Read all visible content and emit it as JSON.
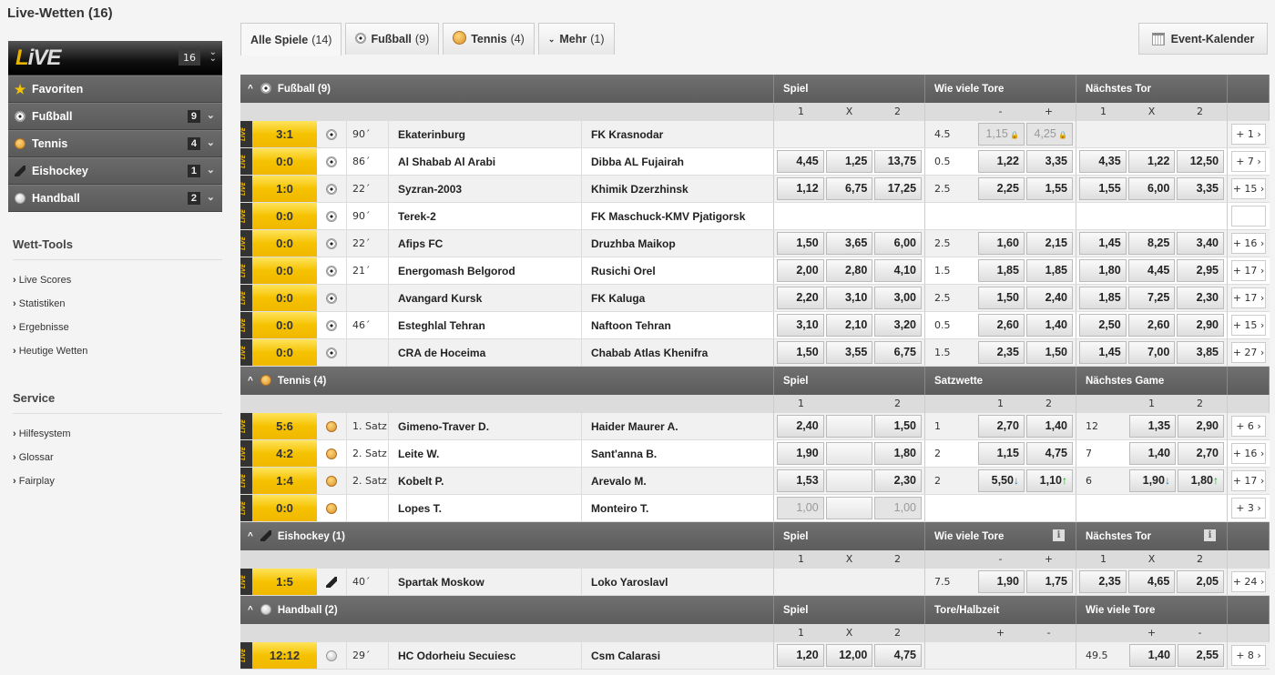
{
  "page": {
    "title": "Live-Wetten (16)"
  },
  "sidebar": {
    "live_logo": {
      "l": "L",
      "rest": "iVE"
    },
    "live_count": "16",
    "items": [
      {
        "label": "Favoriten",
        "icon": "star-icon",
        "count": null
      },
      {
        "label": "Fußball",
        "icon": "soccer-ball-icon",
        "count": "9"
      },
      {
        "label": "Tennis",
        "icon": "tennis-ball-icon",
        "count": "4"
      },
      {
        "label": "Eishockey",
        "icon": "hockey-stick-icon",
        "count": "1"
      },
      {
        "label": "Handball",
        "icon": "handball-icon",
        "count": "2"
      }
    ],
    "wett_tools": {
      "title": "Wett-Tools",
      "links": [
        "Live Scores",
        "Statistiken",
        "Ergebnisse",
        "Heutige Wetten"
      ]
    },
    "service": {
      "title": "Service",
      "links": [
        "Hilfesystem",
        "Glossar",
        "Fairplay"
      ]
    }
  },
  "tabs": [
    {
      "label": "Alle Spiele",
      "count": "(14)",
      "active": true
    },
    {
      "label": "Fußball",
      "count": "(9)",
      "icon": "soccer-ball-icon"
    },
    {
      "label": "Tennis",
      "count": "(4)",
      "icon": "tennis-ball-icon"
    },
    {
      "label": "Mehr",
      "count": "(1)",
      "icon": "chevron-down-icon"
    }
  ],
  "event_calendar": {
    "label": "Event-Kalender"
  },
  "sections": [
    {
      "title": "Fußball (9)",
      "sport": "soccer",
      "markets": [
        {
          "title": "Spiel",
          "cols": [
            "1",
            "X",
            "2"
          ],
          "info": false
        },
        {
          "title": "Wie viele Tore",
          "cols": [
            "",
            "-",
            "+"
          ],
          "info": false
        },
        {
          "title": "Nächstes Tor",
          "cols": [
            "1",
            "X",
            "2"
          ],
          "info": false
        }
      ],
      "rows": [
        {
          "score": "3:1",
          "time": "90´",
          "home": "Ekaterinburg",
          "away": "FK Krasnodar",
          "m1": null,
          "m2": {
            "line": "4.5",
            "odds": [
              "1,15",
              "4,25"
            ],
            "locked": true
          },
          "m3": null,
          "more": "+ 1"
        },
        {
          "score": "0:0",
          "time": "86´",
          "home": "Al Shabab Al Arabi",
          "away": "Dibba AL Fujairah",
          "m1": [
            "4,45",
            "1,25",
            "13,75"
          ],
          "m2": {
            "line": "0.5",
            "odds": [
              "1,22",
              "3,35"
            ]
          },
          "m3": [
            "4,35",
            "1,22",
            "12,50"
          ],
          "more": "+ 7"
        },
        {
          "score": "1:0",
          "time": "22´",
          "home": "Syzran-2003",
          "away": "Khimik Dzerzhinsk",
          "m1": [
            "1,12",
            "6,75",
            "17,25"
          ],
          "m2": {
            "line": "2.5",
            "odds": [
              "2,25",
              "1,55"
            ]
          },
          "m3": [
            "1,55",
            "6,00",
            "3,35"
          ],
          "more": "+ 15"
        },
        {
          "score": "0:0",
          "time": "90´",
          "home": "Terek-2",
          "away": "FK Maschuck-KMV Pjatigorsk",
          "m1": null,
          "m2": null,
          "m3": null,
          "more": ""
        },
        {
          "score": "0:0",
          "time": "22´",
          "home": "Afips FC",
          "away": "Druzhba Maikop",
          "m1": [
            "1,50",
            "3,65",
            "6,00"
          ],
          "m2": {
            "line": "2.5",
            "odds": [
              "1,60",
              "2,15"
            ]
          },
          "m3": [
            "1,45",
            "8,25",
            "3,40"
          ],
          "more": "+ 16"
        },
        {
          "score": "0:0",
          "time": "21´",
          "home": "Energomash Belgorod",
          "away": "Rusichi Orel",
          "m1": [
            "2,00",
            "2,80",
            "4,10"
          ],
          "m2": {
            "line": "1.5",
            "odds": [
              "1,85",
              "1,85"
            ]
          },
          "m3": [
            "1,80",
            "4,45",
            "2,95"
          ],
          "more": "+ 17"
        },
        {
          "score": "0:0",
          "time": "",
          "home": "Avangard Kursk",
          "away": "FK Kaluga",
          "m1": [
            "2,20",
            "3,10",
            "3,00"
          ],
          "m2": {
            "line": "2.5",
            "odds": [
              "1,50",
              "2,40"
            ]
          },
          "m3": [
            "1,85",
            "7,25",
            "2,30"
          ],
          "more": "+ 17"
        },
        {
          "score": "0:0",
          "time": "46´",
          "home": "Esteghlal Tehran",
          "away": "Naftoon Tehran",
          "m1": [
            "3,10",
            "2,10",
            "3,20"
          ],
          "m2": {
            "line": "0.5",
            "odds": [
              "2,60",
              "1,40"
            ]
          },
          "m3": [
            "2,50",
            "2,60",
            "2,90"
          ],
          "more": "+ 15"
        },
        {
          "score": "0:0",
          "time": "",
          "home": "CRA de Hoceima",
          "away": "Chabab Atlas Khenifra",
          "m1": [
            "1,50",
            "3,55",
            "6,75"
          ],
          "m2": {
            "line": "1.5",
            "odds": [
              "2,35",
              "1,50"
            ]
          },
          "m3": [
            "1,45",
            "7,00",
            "3,85"
          ],
          "more": "+ 27"
        }
      ]
    },
    {
      "title": "Tennis (4)",
      "sport": "tennis",
      "markets": [
        {
          "title": "Spiel",
          "cols": [
            "1",
            "",
            "2"
          ],
          "info": false
        },
        {
          "title": "Satzwette",
          "cols": [
            "",
            "1",
            "2"
          ],
          "info": false
        },
        {
          "title": "Nächstes Game",
          "cols": [
            "",
            "1",
            "2"
          ],
          "info": false
        }
      ],
      "rows": [
        {
          "score": "5:6",
          "time": "1. Satz",
          "home": "Gimeno-Traver D.",
          "away": "Haider Maurer A.",
          "m1": [
            "2,40",
            "",
            "1,50"
          ],
          "m2": {
            "line": "1",
            "odds": [
              "2,70",
              "1,40"
            ]
          },
          "m3t": {
            "line": "12",
            "odds": [
              "1,35",
              "2,90"
            ]
          },
          "more": "+ 6"
        },
        {
          "score": "4:2",
          "time": "2. Satz",
          "home": "Leite W.",
          "away": "Sant'anna B.",
          "m1": [
            "1,90",
            "",
            "1,80"
          ],
          "m2": {
            "line": "2",
            "odds": [
              "1,15",
              "4,75"
            ]
          },
          "m3t": {
            "line": "7",
            "odds": [
              "1,40",
              "2,70"
            ]
          },
          "more": "+ 16"
        },
        {
          "score": "1:4",
          "time": "2. Satz",
          "home": "Kobelt P.",
          "away": "Arevalo M.",
          "m1": [
            "1,53",
            "",
            "2,30"
          ],
          "m2": {
            "line": "2",
            "odds": [
              "5,50",
              "1,10"
            ],
            "trend": [
              "down",
              "up"
            ]
          },
          "m3t": {
            "line": "6",
            "odds": [
              "1,90",
              "1,80"
            ],
            "trend": [
              "down",
              "up"
            ]
          },
          "more": "+ 17"
        },
        {
          "score": "0:0",
          "time": "",
          "home": "Lopes T.",
          "away": "Monteiro T.",
          "m1": [
            "1,00",
            "",
            "1,00"
          ],
          "m1locked": true,
          "m2": null,
          "m3t": null,
          "more": "+ 3"
        }
      ]
    },
    {
      "title": "Eishockey (1)",
      "sport": "hockey",
      "markets": [
        {
          "title": "Spiel",
          "cols": [
            "1",
            "X",
            "2"
          ],
          "info": false
        },
        {
          "title": "Wie viele Tore",
          "cols": [
            "",
            "-",
            "+"
          ],
          "info": true
        },
        {
          "title": "Nächstes Tor",
          "cols": [
            "1",
            "X",
            "2"
          ],
          "info": true
        }
      ],
      "rows": [
        {
          "score": "1:5",
          "time": "40´",
          "home": "Spartak Moskow",
          "away": "Loko Yaroslavl",
          "m1": null,
          "m2": {
            "line": "7.5",
            "odds": [
              "1,90",
              "1,75"
            ]
          },
          "m3": [
            "2,35",
            "4,65",
            "2,05"
          ],
          "more": "+ 24"
        }
      ]
    },
    {
      "title": "Handball (2)",
      "sport": "handball",
      "markets": [
        {
          "title": "Spiel",
          "cols": [
            "1",
            "X",
            "2"
          ],
          "info": false
        },
        {
          "title": "Tore/Halbzeit",
          "cols": [
            "",
            "+",
            "-"
          ],
          "info": false
        },
        {
          "title": "Wie viele Tore",
          "cols": [
            "",
            "+",
            "-"
          ],
          "info": false
        }
      ],
      "rows": [
        {
          "score": "12:12",
          "time": "29´",
          "home": "HC Odorheiu Secuiesc",
          "away": "Csm Calarasi",
          "m1": [
            "1,20",
            "12,00",
            "4,75"
          ],
          "m2": null,
          "m3t": {
            "line": "49.5",
            "odds": [
              "1,40",
              "2,55"
            ]
          },
          "more": "+ 8"
        }
      ]
    }
  ],
  "live_tag": "LIVE",
  "colors": {
    "score_bg": "#f5c200",
    "header_bg": "#646464",
    "trend_down": "#1a7fc0",
    "trend_up": "#18a018"
  }
}
